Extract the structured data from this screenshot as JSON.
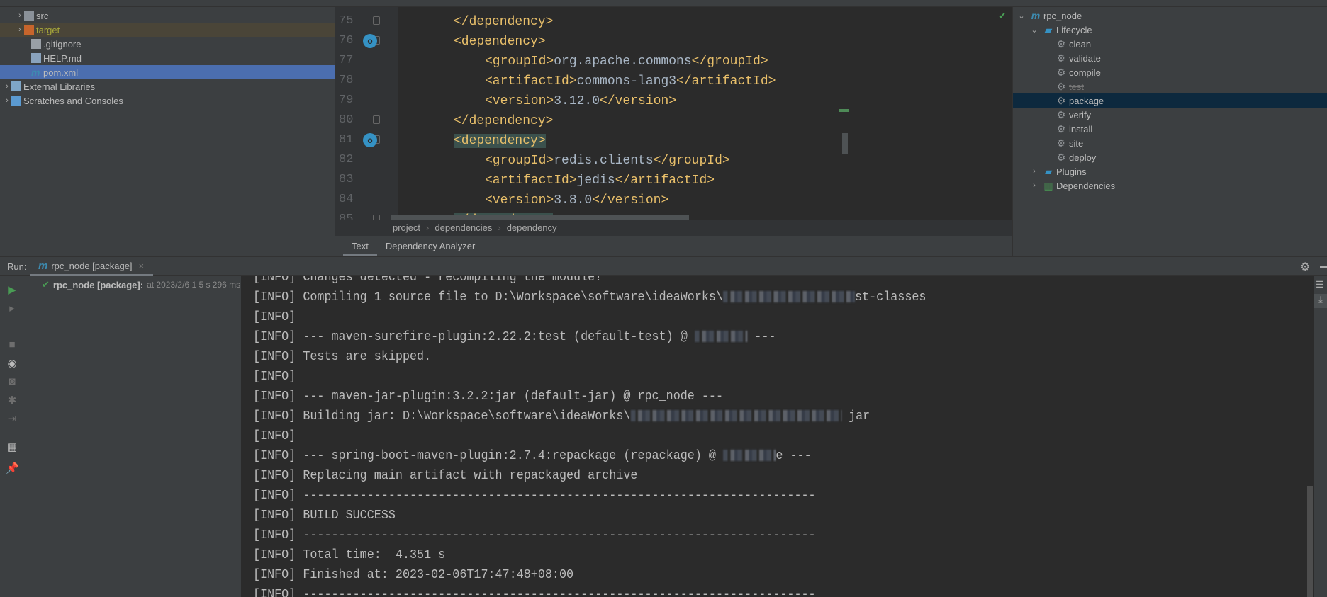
{
  "project_tree": {
    "items": [
      {
        "label": "src",
        "icon": "folder-icon",
        "expanded": false
      },
      {
        "label": "target",
        "icon": "folder-excluded-icon",
        "expanded": false
      },
      {
        "label": ".gitignore",
        "icon": "gitignore-file-icon"
      },
      {
        "label": "HELP.md",
        "icon": "markdown-file-icon"
      },
      {
        "label": "pom.xml",
        "icon": "maven-file-icon",
        "selected": true
      },
      {
        "label": "External Libraries",
        "icon": "libraries-icon"
      },
      {
        "label": "Scratches and Consoles",
        "icon": "scratches-icon"
      }
    ]
  },
  "editor": {
    "lines": [
      {
        "n": "75",
        "indent": 1,
        "parts": [
          [
            "tag",
            "</dependency>"
          ]
        ]
      },
      {
        "n": "76",
        "indent": 1,
        "parts": [
          [
            "tag",
            "<dependency>"
          ]
        ],
        "maven_marker": true
      },
      {
        "n": "77",
        "indent": 2,
        "parts": [
          [
            "tag",
            "<groupId>"
          ],
          [
            "text",
            "org.apache.commons"
          ],
          [
            "tag",
            "</groupId>"
          ]
        ]
      },
      {
        "n": "78",
        "indent": 2,
        "parts": [
          [
            "tag",
            "<artifactId>"
          ],
          [
            "text",
            "commons-lang3"
          ],
          [
            "tag",
            "</artifactId>"
          ]
        ]
      },
      {
        "n": "79",
        "indent": 2,
        "parts": [
          [
            "tag",
            "<version>"
          ],
          [
            "text",
            "3.12.0"
          ],
          [
            "tag",
            "</version>"
          ]
        ]
      },
      {
        "n": "80",
        "indent": 1,
        "parts": [
          [
            "tag",
            "</dependency>"
          ]
        ]
      },
      {
        "n": "81",
        "indent": 1,
        "parts": [
          [
            "tag",
            "<dependency>"
          ]
        ],
        "maven_marker": true,
        "highlight": true
      },
      {
        "n": "82",
        "indent": 2,
        "parts": [
          [
            "tag",
            "<groupId>"
          ],
          [
            "text",
            "redis.clients"
          ],
          [
            "tag",
            "</groupId>"
          ]
        ]
      },
      {
        "n": "83",
        "indent": 2,
        "parts": [
          [
            "tag",
            "<artifactId>"
          ],
          [
            "text",
            "jedis"
          ],
          [
            "tag",
            "</artifactId>"
          ]
        ]
      },
      {
        "n": "84",
        "indent": 2,
        "parts": [
          [
            "tag",
            "<version>"
          ],
          [
            "text",
            "3.8.0"
          ],
          [
            "tag",
            "</version>"
          ]
        ]
      },
      {
        "n": "85",
        "indent": 1,
        "parts": [
          [
            "tag",
            "</dependency>"
          ]
        ],
        "highlight": true
      }
    ],
    "breadcrumb": [
      "project",
      "dependencies",
      "dependency"
    ],
    "tabs": [
      {
        "label": "Text",
        "active": true
      },
      {
        "label": "Dependency Analyzer"
      }
    ],
    "tag_color": "#e8bf6a",
    "text_color": "#a9b7c6"
  },
  "maven": {
    "root": "rpc_node",
    "lifecycle_label": "Lifecycle",
    "phases": [
      {
        "label": "clean"
      },
      {
        "label": "validate"
      },
      {
        "label": "compile"
      },
      {
        "label": "test",
        "skipped": true
      },
      {
        "label": "package",
        "selected": true
      },
      {
        "label": "verify"
      },
      {
        "label": "install"
      },
      {
        "label": "site"
      },
      {
        "label": "deploy"
      }
    ],
    "plugins_label": "Plugins",
    "dependencies_label": "Dependencies"
  },
  "run": {
    "label": "Run:",
    "tab_label": "rpc_node [package]",
    "tree_item": {
      "name": "rpc_node [package]:",
      "detail": "at 2023/2/6 1 5 s 296 ms"
    },
    "console_lines": [
      {
        "text": "[INFO] Changes detected - recompiling the module!"
      },
      {
        "text": "[INFO] Compiling 1 source file to D:\\Workspace\\software\\ideaWorks\\",
        "redacted": true,
        "after": "st-classes"
      },
      {
        "text": "[INFO]"
      },
      {
        "text": "[INFO] --- maven-surefire-plugin:2.22.2:test (default-test) @ ",
        "redacted": true,
        "after": " ---"
      },
      {
        "text": "[INFO] Tests are skipped."
      },
      {
        "text": "[INFO]"
      },
      {
        "text": "[INFO] --- maven-jar-plugin:3.2.2:jar (default-jar) @ rpc_node ---"
      },
      {
        "text": "[INFO] Building jar: D:\\Workspace\\software\\ideaWorks\\",
        "redacted": true,
        "after": " jar"
      },
      {
        "text": "[INFO]"
      },
      {
        "text": "[INFO] --- spring-boot-maven-plugin:2.7.4:repackage (repackage) @ ",
        "redacted": true,
        "after": "e ---"
      },
      {
        "text": "[INFO] Replacing main artifact with repackaged archive"
      },
      {
        "text": "[INFO] ------------------------------------------------------------------------"
      },
      {
        "text": "[INFO] BUILD SUCCESS"
      },
      {
        "text": "[INFO] ------------------------------------------------------------------------"
      },
      {
        "text": "[INFO] Total time:  4.351 s"
      },
      {
        "text": "[INFO] Finished at: 2023-02-06T17:47:48+08:00"
      },
      {
        "text": "[INFO] ------------------------------------------------------------------------"
      }
    ]
  },
  "colors": {
    "selection": "#4b6eaf",
    "maven_selection": "#0d293e",
    "success": "#499c54"
  }
}
